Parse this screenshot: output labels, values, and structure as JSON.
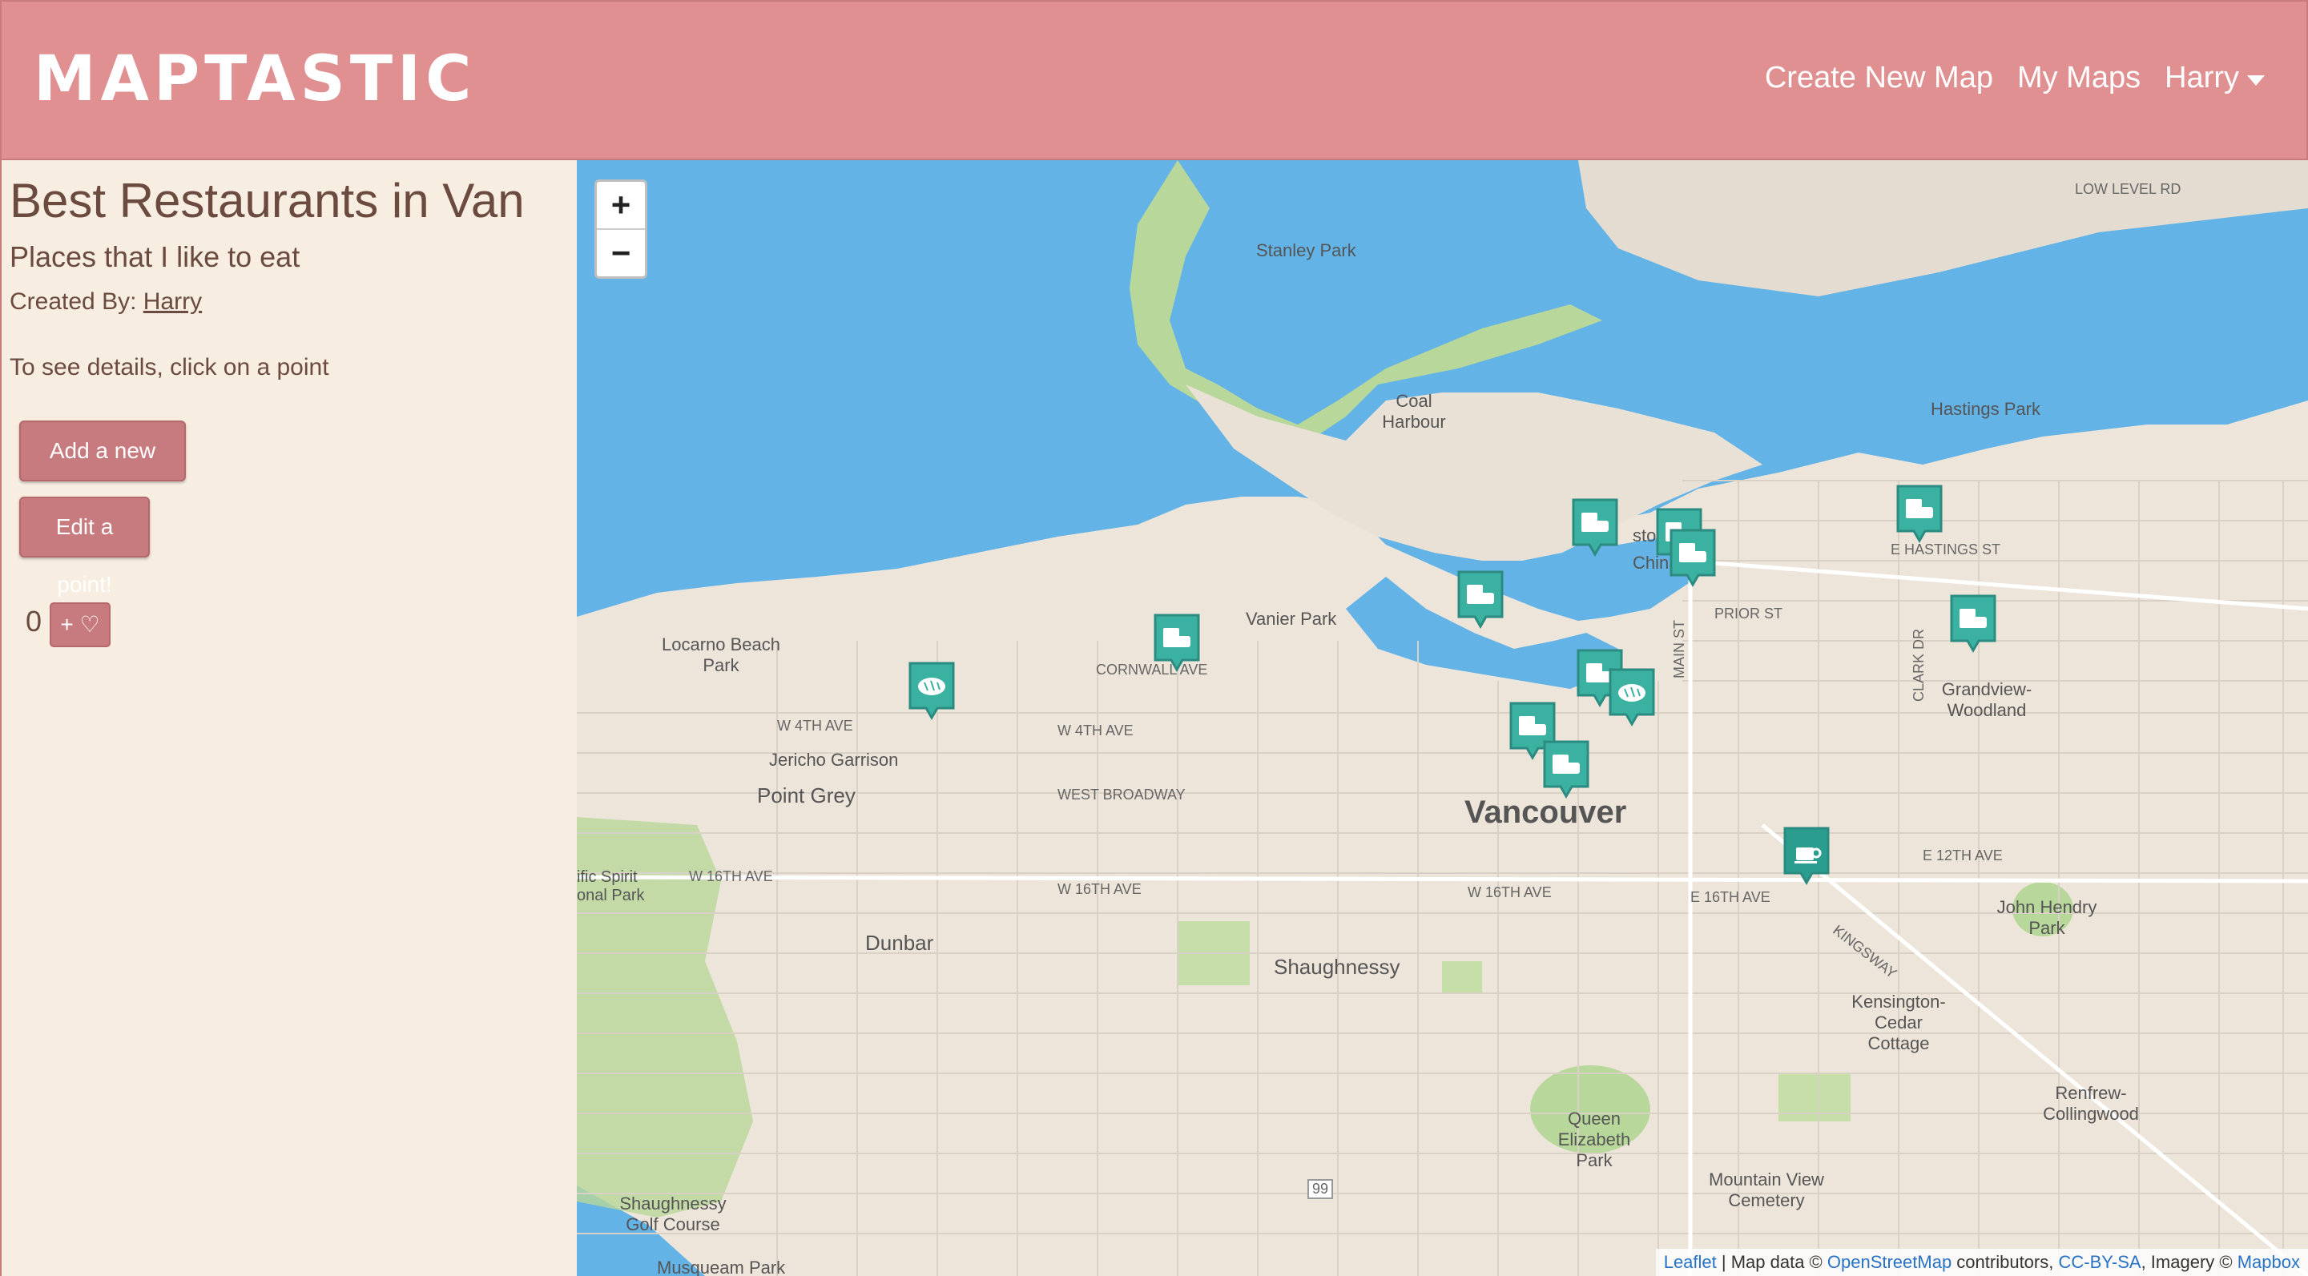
{
  "app": {
    "brand": "MAPTASTIC"
  },
  "nav": {
    "create": "Create New Map",
    "my_maps": "My Maps",
    "user": "Harry"
  },
  "map_info": {
    "title": "Best Restaurants in Van",
    "description": "Places that I like to eat",
    "created_by_label": "Created By:",
    "author": "Harry",
    "hint": "To see details, click on a point"
  },
  "buttons": {
    "add_point": "Add a new point!",
    "edit_point": "Edit a point!",
    "like": "+ ♡"
  },
  "likes": {
    "count": "0"
  },
  "zoom": {
    "in": "+",
    "out": "−"
  },
  "attribution": {
    "leaflet": "Leaflet",
    "sep1": " | Map data © ",
    "osm": "OpenStreetMap",
    "contrib": " contributors, ",
    "license": "CC-BY-SA",
    "imagery": ", Imagery © ",
    "mapbox": "Mapbox"
  },
  "map_labels": {
    "stanley_park": "Stanley Park",
    "coal_harbour": "Coal Harbour",
    "vanier_park": "Vanier Park",
    "locarno": "Locarno Beach Park",
    "jericho": "Jericho Garrison",
    "point_grey": "Point Grey",
    "vancouver": "Vancouver",
    "dunbar": "Dunbar",
    "shaughnessy": "Shaughnessy",
    "grandview": "Grandview-Woodland",
    "john_hendry": "John Hendry Park",
    "kensington": "Kensington-Cedar Cottage",
    "renfrew": "Renfrew-Collingwood",
    "queen_elizabeth": "Queen Elizabeth Park",
    "mountain_view": "Mountain View Cemetery",
    "shaughnessy_golf": "Shaughnessy Golf Course",
    "musqueam": "Musqueam Park",
    "hastings_park": "Hastings Park",
    "chinatown": "China",
    "gastown": "stow",
    "w4th": "W 4TH AVE",
    "w16th": "W 16TH AVE",
    "e16th": "E 16TH AVE",
    "e12th": "E 12TH AVE",
    "west_broadway": "WEST BROADWAY",
    "cornwall": "CORNWALL AVE",
    "kingsway": "KINGSWAY",
    "main": "MAIN ST",
    "clark": "CLARK DR",
    "e_hastings": "E HASTINGS ST",
    "prior": "PRIOR ST",
    "low_level": "LOW LEVEL RD",
    "spirit": "ific Spirit onal Park",
    "hwy99": "99"
  },
  "markers": [
    {
      "icon": "restaurant-icon",
      "kind": "restaurant"
    },
    {
      "icon": "restaurant-icon",
      "kind": "restaurant"
    },
    {
      "icon": "restaurant-icon",
      "kind": "restaurant"
    },
    {
      "icon": "restaurant-icon",
      "kind": "restaurant"
    },
    {
      "icon": "restaurant-icon",
      "kind": "restaurant"
    },
    {
      "icon": "restaurant-icon",
      "kind": "restaurant"
    },
    {
      "icon": "restaurant-icon",
      "kind": "restaurant"
    },
    {
      "icon": "restaurant-icon",
      "kind": "restaurant"
    },
    {
      "icon": "restaurant-icon",
      "kind": "restaurant"
    },
    {
      "icon": "restaurant-icon",
      "kind": "restaurant"
    },
    {
      "icon": "bakery-icon",
      "kind": "bakery"
    },
    {
      "icon": "bakery-icon",
      "kind": "bakery"
    },
    {
      "icon": "cafe-icon",
      "kind": "cafe"
    }
  ],
  "colors": {
    "header": "#e09091",
    "sidebar": "#f7ede1",
    "button": "#c77b7f",
    "water": "#63b3e6",
    "marker": "#3bb2a1"
  }
}
